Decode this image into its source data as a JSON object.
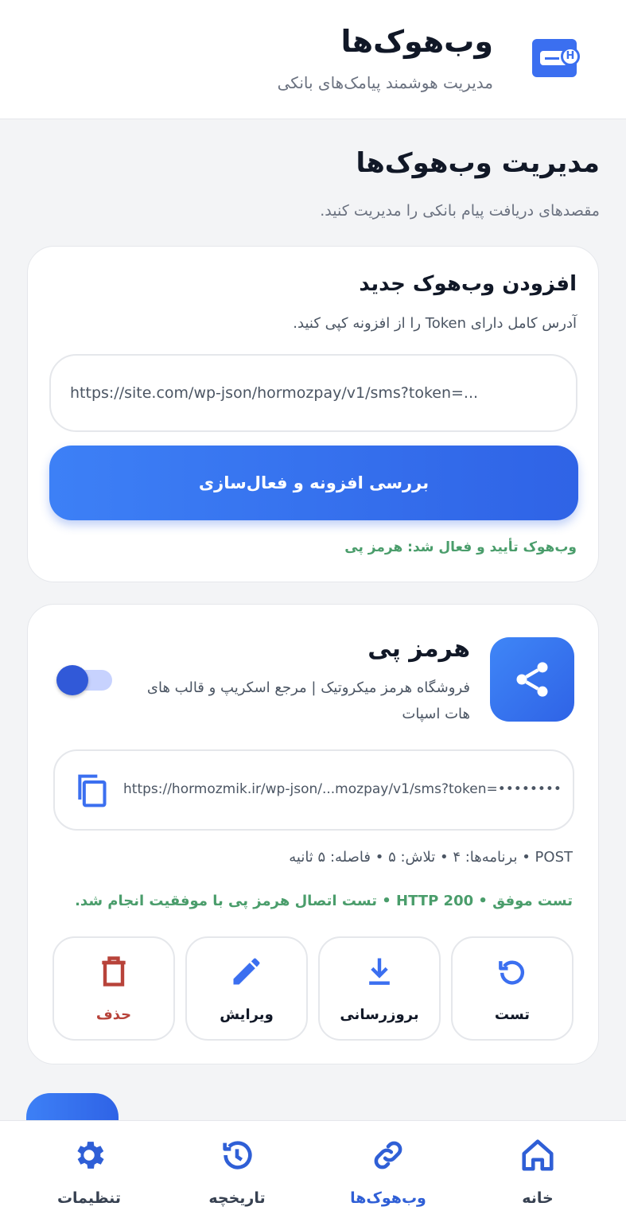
{
  "header": {
    "title": "وب‌هوک‌ها",
    "subtitle": "مدیریت هوشمند پیامک‌های بانکی",
    "logo_badge": "H"
  },
  "page": {
    "title": "مدیریت وب‌هوک‌ها",
    "subtitle": "مقصدهای دریافت پیام بانکی را مدیریت کنید."
  },
  "add_card": {
    "title": "افزودن وب‌هوک جدید",
    "description": "آدرس کامل دارای Token را از افزونه کپی کنید.",
    "url_placeholder": "https://site.com/wp-json/hormozpay/v1/sms?token=...",
    "url_value": "",
    "submit_label": "بررسی افزونه و فعال‌سازی",
    "status_text": "وب‌هوک تأیید و فعال شد: هرمز پی"
  },
  "webhook": {
    "name": "هرمز پی",
    "description": "فروشگاه هرمز میکروتیک | مرجع اسکریپ و قالب های هات اسپات",
    "enabled": true,
    "url": "https://hormozmik.ir/wp-json/...mozpay/v1/sms?token=••••••••",
    "meta": "POST • برنامه‌ها: ۴ • تلاش: ۵ • فاصله: ۵ ثانیه",
    "test_status": "تست موفق • HTTP 200 • تست اتصال هرمز پی با موفقیت انجام شد.",
    "actions": {
      "test": "تست",
      "update": "بروزرسانی",
      "edit": "ویرایش",
      "delete": "حذف"
    }
  },
  "nav": {
    "home": "خانه",
    "webhooks": "وب‌هوک‌ها",
    "history": "تاریخچه",
    "settings": "تنظیمات",
    "active": "webhooks"
  },
  "colors": {
    "accent": "#3b6ff0",
    "success": "#4a9d6b",
    "danger": "#b8433a",
    "background": "#f3f4f6"
  }
}
